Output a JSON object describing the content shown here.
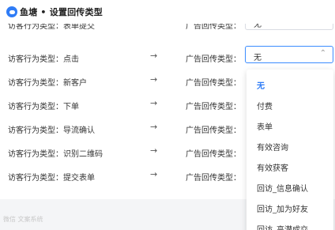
{
  "titlebar": {
    "title": "鱼塘 • 设置回传类型"
  },
  "top_partial_row": {
    "left": "访客行为类型：表单提交",
    "right": "广告回传类型：",
    "value": "无"
  },
  "rows": [
    {
      "left": "访客行为类型：点击",
      "arrow": "→",
      "right": "广告回传类型：",
      "value": "无",
      "chevron": "⌃"
    },
    {
      "left": "访客行为类型：新客户",
      "arrow": "→",
      "right": "广告回传类型："
    },
    {
      "left": "访客行为类型：下单",
      "arrow": "→",
      "right": "广告回传类型："
    },
    {
      "left": "访客行为类型：导流确认",
      "arrow": "→",
      "right": "广告回传类型："
    },
    {
      "left": "访客行为类型：识别二维码",
      "arrow": "→",
      "right": "广告回传类型："
    },
    {
      "left": "访客行为类型：提交表单",
      "arrow": "→",
      "right": "广告回传类型："
    }
  ],
  "dropdown": {
    "options": [
      "无",
      "付费",
      "表单",
      "有效咨询",
      "有效获客",
      "回访_信息确认",
      "回访_加为好友",
      "回访_高潜成交"
    ],
    "selected": "无"
  },
  "footer": {
    "watermark": "微信 文案系统"
  },
  "colors": {
    "accent": "#2f7cf6",
    "border": "#d9dce2"
  }
}
